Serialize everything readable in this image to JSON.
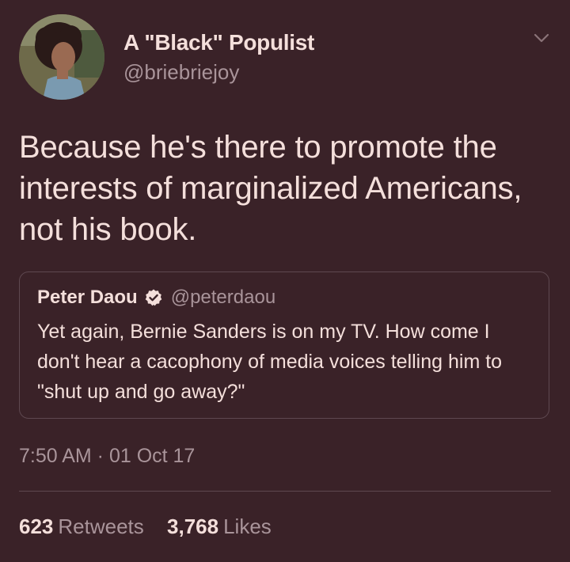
{
  "author": {
    "display_name": "A \"Black\" Populist",
    "handle": "@briebriejoy"
  },
  "tweet": {
    "text": "Because he's there to promote the interests of marginalized Americans, not his book."
  },
  "quoted_tweet": {
    "display_name": "Peter Daou",
    "handle": "@peterdaou",
    "verified": true,
    "text": "Yet again, Bernie Sanders is on my TV. How come I don't hear a cacophony of media voices telling him to \"shut up and go away?\""
  },
  "meta": {
    "timestamp": "7:50 AM · 01 Oct 17"
  },
  "stats": {
    "retweets_count": "623",
    "retweets_label": "Retweets",
    "likes_count": "3,768",
    "likes_label": "Likes"
  },
  "icons": {
    "menu": "chevron-down-icon",
    "verified": "verified-badge-icon"
  },
  "colors": {
    "background": "#3a2228",
    "text_primary": "#f4dfdb",
    "text_secondary": "#a9949a",
    "border": "#5e4850"
  }
}
